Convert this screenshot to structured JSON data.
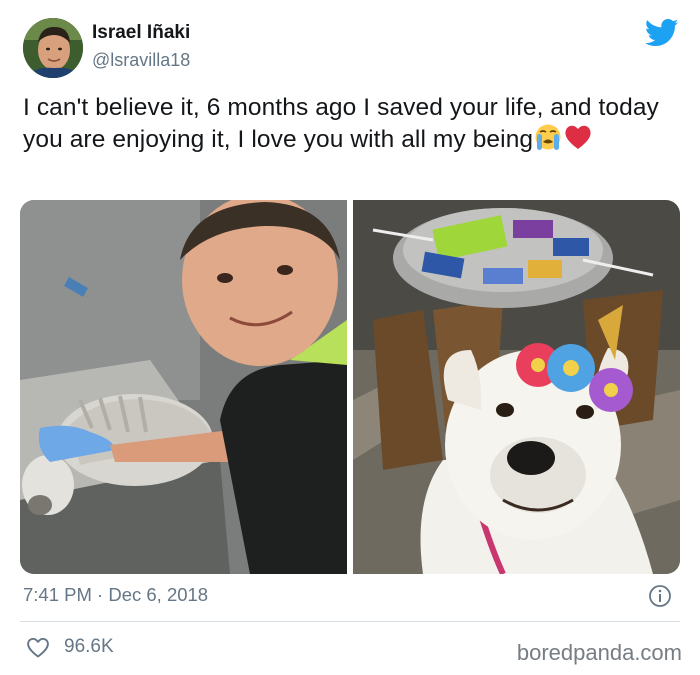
{
  "author": {
    "display_name": "Israel Iñaki",
    "handle": "@lsravilla18"
  },
  "tweet": {
    "text": "I can't believe it, 6 months ago I saved your life, and today you are enjoying it, I love you with all my being",
    "emojis": [
      "loudly-crying-face-emoji",
      "red-heart-emoji"
    ]
  },
  "media": {
    "photos": [
      {
        "description_icon": "photo-man-with-emaciated-dog"
      },
      {
        "description_icon": "photo-healthy-dog-with-flower-crown"
      }
    ]
  },
  "footer": {
    "timestamp": "7:41 PM · Dec 6, 2018",
    "like_count": "96.6K"
  },
  "watermark": "boredpanda.com",
  "colors": {
    "twitter_blue": "#1da1f2",
    "secondary_text": "#657786",
    "divider": "#d8dfe5"
  }
}
